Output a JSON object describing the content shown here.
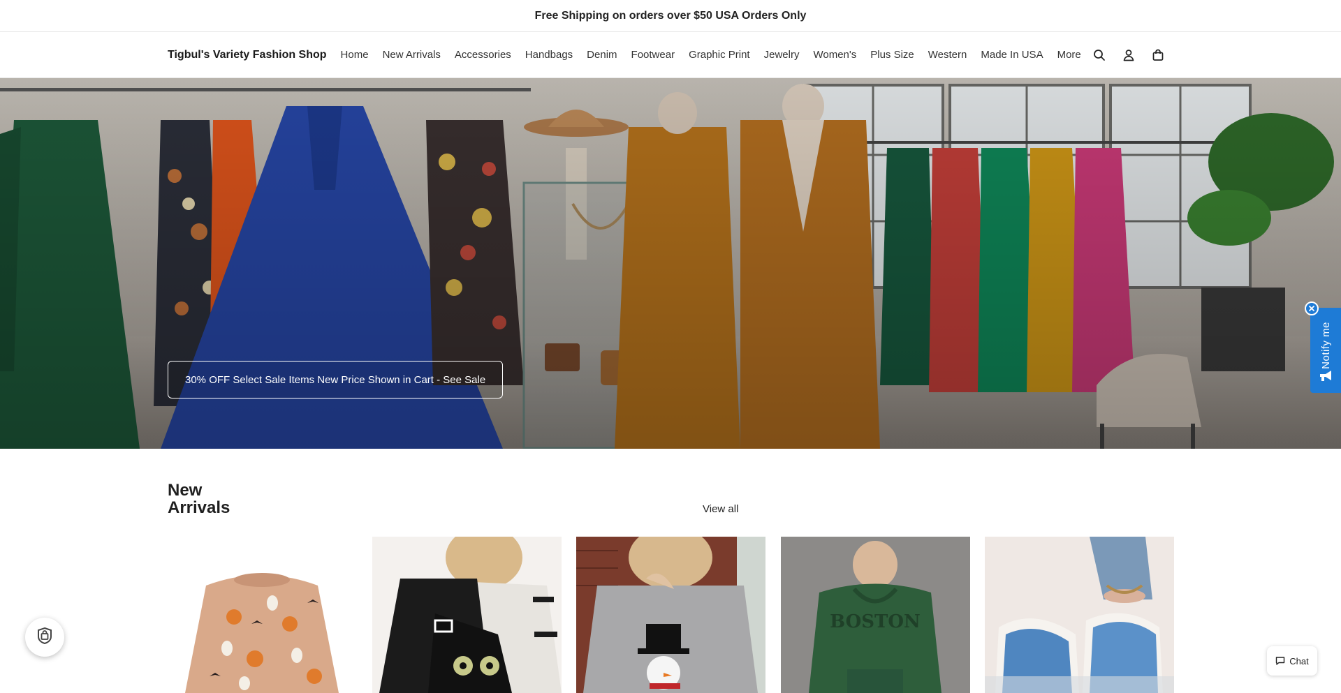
{
  "announcement": {
    "text": "Free Shipping on orders over $50 USA Orders Only"
  },
  "header": {
    "logo": "Tigbul's Variety Fashion Shop",
    "nav": [
      {
        "label": "Home"
      },
      {
        "label": "New Arrivals"
      },
      {
        "label": "Accessories"
      },
      {
        "label": "Handbags"
      },
      {
        "label": "Denim"
      },
      {
        "label": "Footwear"
      },
      {
        "label": "Graphic Print"
      },
      {
        "label": "Jewelry"
      },
      {
        "label": "Women's"
      },
      {
        "label": "Plus Size"
      },
      {
        "label": "Western"
      },
      {
        "label": "Made In USA"
      },
      {
        "label": "More"
      }
    ],
    "icons": [
      "search-icon",
      "account-icon",
      "cart-icon"
    ]
  },
  "hero": {
    "button_label": "30% OFF Select Sale Items New Price Shown in Cart - See Sale"
  },
  "notify": {
    "label": "Notify me"
  },
  "new_arrivals": {
    "title": "New Arrivals",
    "view_all": "View all",
    "products": [
      {
        "name": "Halloween pumpkin ghost sweater"
      },
      {
        "name": "Black cat sweater"
      },
      {
        "name": "Snowman sweater"
      },
      {
        "name": "Boston hoodie set"
      },
      {
        "name": "Denim slippers"
      }
    ]
  },
  "chat": {
    "label": "Chat"
  },
  "colors": {
    "notify_blue": "#1e7bd6",
    "text": "#1f1f1f",
    "border": "#e6e6e6"
  }
}
